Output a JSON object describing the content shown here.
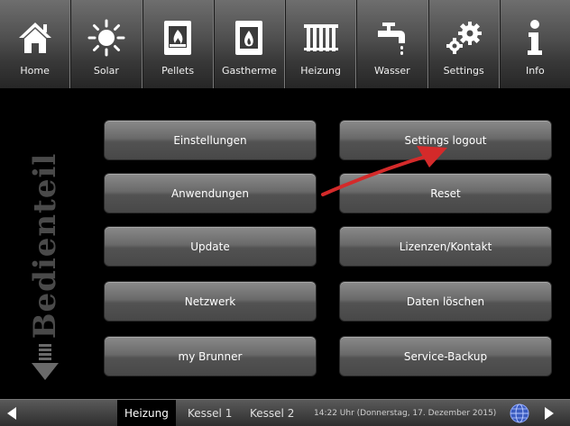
{
  "nav": {
    "items": [
      {
        "label": "Home",
        "icon": "home-icon"
      },
      {
        "label": "Solar",
        "icon": "sun-icon"
      },
      {
        "label": "Pellets",
        "icon": "pellet-boiler-icon"
      },
      {
        "label": "Gastherme",
        "icon": "gas-boiler-icon"
      },
      {
        "label": "Heizung",
        "icon": "radiator-icon"
      },
      {
        "label": "Wasser",
        "icon": "faucet-icon"
      },
      {
        "label": "Settings",
        "icon": "gears-icon"
      },
      {
        "label": "Info",
        "icon": "info-icon"
      }
    ]
  },
  "side": {
    "title": "Bedienteil"
  },
  "buttons": {
    "left": [
      "Einstellungen",
      "Anwendungen",
      "Update",
      "Netzwerk",
      "my Brunner"
    ],
    "right": [
      "Settings logout",
      "Reset",
      "Lizenzen/Kontakt",
      "Daten löschen",
      "Service-Backup"
    ]
  },
  "annotation": {
    "arrow_color": "#d42a2a"
  },
  "bottom": {
    "tabs": [
      "Heizung",
      "Kessel 1",
      "Kessel 2"
    ],
    "status": "14:22 Uhr (Donnerstag, 17. Dezember 2015)"
  },
  "colors": {
    "background": "#000000",
    "button_text": "#ffffff",
    "side_title": "#4a4a4a"
  }
}
